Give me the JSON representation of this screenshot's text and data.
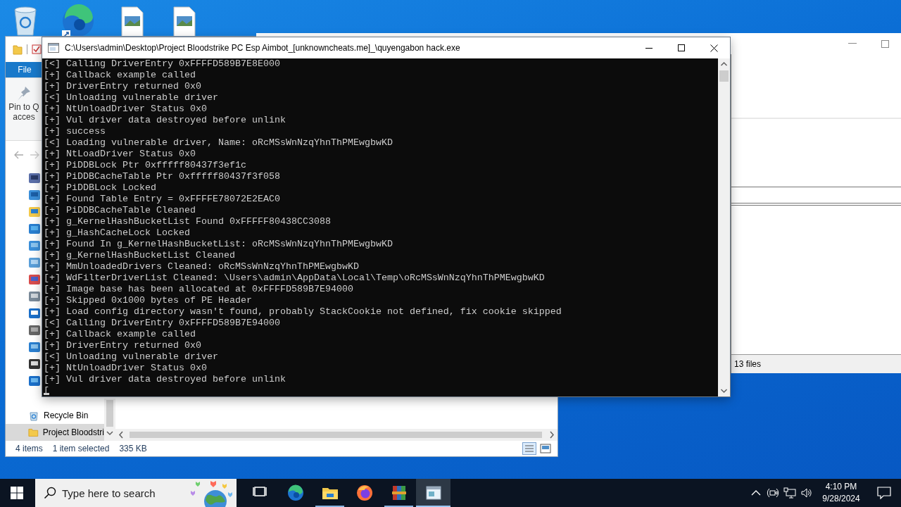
{
  "explorer": {
    "ribbon_tab": "File",
    "pin_button": [
      "Pin to Q",
      "acces"
    ],
    "nav_items": [
      {
        "label": "Recycle Bin",
        "kind": "recycle-bin",
        "selected": false
      },
      {
        "label": "Project Bloodstri",
        "kind": "folder",
        "selected": true
      }
    ],
    "status": {
      "count": "4 items",
      "selection": "1 item selected",
      "size": "335 KB"
    }
  },
  "second_window": {
    "status": "13 files"
  },
  "console": {
    "title": "C:\\Users\\admin\\Desktop\\Project Bloodstrike PC Esp Aimbot_[unknowncheats.me]_\\quyengabon hack.exe",
    "lines": [
      "[<] Calling DriverEntry 0xFFFFD589B7E8E000",
      "[+] Callback example called",
      "[+] DriverEntry returned 0x0",
      "[<] Unloading vulnerable driver",
      "[+] NtUnloadDriver Status 0x0",
      "[+] Vul driver data destroyed before unlink",
      "[+] success",
      "[<] Loading vulnerable driver, Name: oRcMSsWnNzqYhnThPMEwgbwKD",
      "[+] NtLoadDriver Status 0x0",
      "[+] PiDDBLock Ptr 0xfffff80437f3ef1c",
      "[+] PiDDBCacheTable Ptr 0xfffff80437f3f058",
      "[+] PiDDBLock Locked",
      "[+] Found Table Entry = 0xFFFFE78072E2EAC0",
      "[+] PiDDBCacheTable Cleaned",
      "[+] g_KernelHashBucketList Found 0xFFFFF80438CC3088",
      "[+] g_HashCacheLock Locked",
      "[+] Found In g_KernelHashBucketList: oRcMSsWnNzqYhnThPMEwgbwKD",
      "[+] g_KernelHashBucketList Cleaned",
      "[+] MmUnloadedDrivers Cleaned: oRcMSsWnNzqYhnThPMEwgbwKD",
      "[+] WdFilterDriverList Cleaned: \\Users\\admin\\AppData\\Local\\Temp\\oRcMSsWnNzqYhnThPMEwgbwKD",
      "[+] Image base has been allocated at 0xFFFFD589B7E94000",
      "[+] Skipped 0x1000 bytes of PE Header",
      "[+] Load config directory wasn't found, probably StackCookie not defined, fix cookie skipped",
      "[<] Calling DriverEntry 0xFFFFD589B7E94000",
      "[+] Callback example called",
      "[+] DriverEntry returned 0x0",
      "[<] Unloading vulnerable driver",
      "[+] NtUnloadDriver Status 0x0",
      "[+] Vul driver data destroyed before unlink"
    ],
    "prompt": "["
  },
  "taskbar": {
    "search": {
      "placeholder": "Type here to search"
    },
    "apps": [
      {
        "kind": "task-view",
        "running": false,
        "active": false
      },
      {
        "kind": "edge",
        "running": false,
        "active": false
      },
      {
        "kind": "explorer",
        "running": true,
        "active": false
      },
      {
        "kind": "firefox",
        "running": false,
        "active": false
      },
      {
        "kind": "winrar",
        "running": true,
        "active": false
      },
      {
        "kind": "console",
        "running": true,
        "active": true
      }
    ],
    "clock": {
      "time": "4:10 PM",
      "date": "9/28/2024"
    }
  }
}
